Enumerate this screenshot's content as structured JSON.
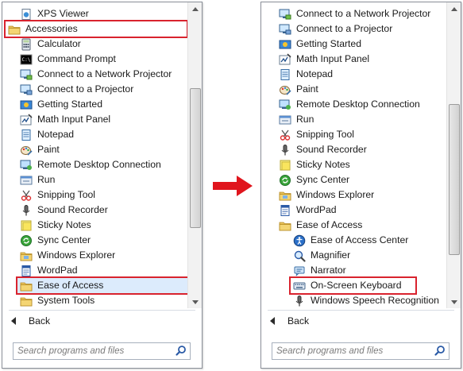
{
  "colors": {
    "highlight_border": "#d9232e",
    "selected_bg": "#dcebfc",
    "arrow": "#e0151d"
  },
  "left_panel": {
    "items": [
      {
        "label": "XPS Viewer",
        "icon": "xps-viewer-icon",
        "indent": 1
      },
      {
        "label": "Accessories",
        "icon": "folder-icon",
        "indent": 0,
        "highlight": true
      },
      {
        "label": "Calculator",
        "icon": "calculator-icon",
        "indent": 1
      },
      {
        "label": "Command Prompt",
        "icon": "command-prompt-icon",
        "indent": 1
      },
      {
        "label": "Connect to a Network Projector",
        "icon": "network-projector-icon",
        "indent": 1
      },
      {
        "label": "Connect to a Projector",
        "icon": "projector-icon",
        "indent": 1
      },
      {
        "label": "Getting Started",
        "icon": "getting-started-icon",
        "indent": 1
      },
      {
        "label": "Math Input Panel",
        "icon": "math-input-icon",
        "indent": 1
      },
      {
        "label": "Notepad",
        "icon": "notepad-icon",
        "indent": 1
      },
      {
        "label": "Paint",
        "icon": "paint-icon",
        "indent": 1
      },
      {
        "label": "Remote Desktop Connection",
        "icon": "remote-desktop-icon",
        "indent": 1
      },
      {
        "label": "Run",
        "icon": "run-icon",
        "indent": 1
      },
      {
        "label": "Snipping Tool",
        "icon": "snipping-tool-icon",
        "indent": 1
      },
      {
        "label": "Sound Recorder",
        "icon": "microphone-icon",
        "indent": 1
      },
      {
        "label": "Sticky Notes",
        "icon": "sticky-notes-icon",
        "indent": 1
      },
      {
        "label": "Sync Center",
        "icon": "sync-center-icon",
        "indent": 1
      },
      {
        "label": "Windows Explorer",
        "icon": "folder-explorer-icon",
        "indent": 1
      },
      {
        "label": "WordPad",
        "icon": "wordpad-icon",
        "indent": 1
      },
      {
        "label": "Ease of Access",
        "icon": "folder-icon",
        "indent": 1,
        "highlight": true,
        "selected": true
      },
      {
        "label": "System Tools",
        "icon": "folder-icon",
        "indent": 1
      }
    ],
    "back_label": "Back",
    "search_placeholder": "Search programs and files"
  },
  "right_panel": {
    "items": [
      {
        "label": "Connect to a Network Projector",
        "icon": "network-projector-icon",
        "indent": 0
      },
      {
        "label": "Connect to a Projector",
        "icon": "projector-icon",
        "indent": 0
      },
      {
        "label": "Getting Started",
        "icon": "getting-started-icon",
        "indent": 0
      },
      {
        "label": "Math Input Panel",
        "icon": "math-input-icon",
        "indent": 0
      },
      {
        "label": "Notepad",
        "icon": "notepad-icon",
        "indent": 0
      },
      {
        "label": "Paint",
        "icon": "paint-icon",
        "indent": 0
      },
      {
        "label": "Remote Desktop Connection",
        "icon": "remote-desktop-icon",
        "indent": 0
      },
      {
        "label": "Run",
        "icon": "run-icon",
        "indent": 0
      },
      {
        "label": "Snipping Tool",
        "icon": "snipping-tool-icon",
        "indent": 0
      },
      {
        "label": "Sound Recorder",
        "icon": "microphone-icon",
        "indent": 0
      },
      {
        "label": "Sticky Notes",
        "icon": "sticky-notes-icon",
        "indent": 0
      },
      {
        "label": "Sync Center",
        "icon": "sync-center-icon",
        "indent": 0
      },
      {
        "label": "Windows Explorer",
        "icon": "folder-explorer-icon",
        "indent": 0
      },
      {
        "label": "WordPad",
        "icon": "wordpad-icon",
        "indent": 0
      },
      {
        "label": "Ease of Access",
        "icon": "folder-icon",
        "indent": 0
      },
      {
        "label": "Ease of Access Center",
        "icon": "ease-of-access-icon",
        "indent": 1
      },
      {
        "label": "Magnifier",
        "icon": "magnifier-icon",
        "indent": 1
      },
      {
        "label": "Narrator",
        "icon": "narrator-icon",
        "indent": 1
      },
      {
        "label": "On-Screen Keyboard",
        "icon": "keyboard-icon",
        "indent": 1,
        "highlight": true
      },
      {
        "label": "Windows Speech Recognition",
        "icon": "microphone-icon",
        "indent": 1
      }
    ],
    "back_label": "Back",
    "search_placeholder": "Search programs and files"
  }
}
